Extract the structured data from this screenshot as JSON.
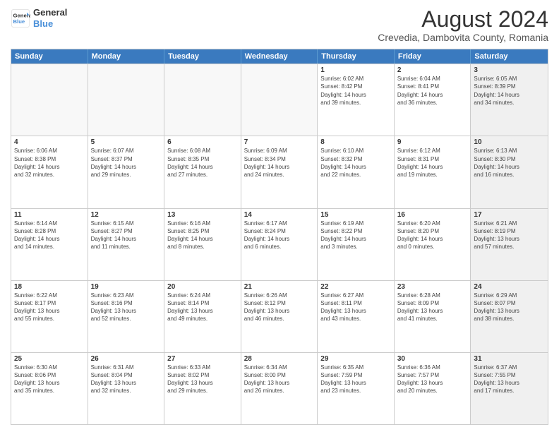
{
  "header": {
    "logo_line1": "General",
    "logo_line2": "Blue",
    "main_title": "August 2024",
    "subtitle": "Crevedia, Dambovita County, Romania"
  },
  "days_of_week": [
    "Sunday",
    "Monday",
    "Tuesday",
    "Wednesday",
    "Thursday",
    "Friday",
    "Saturday"
  ],
  "weeks": [
    [
      {
        "day": "",
        "info": "",
        "shaded": false,
        "empty": true
      },
      {
        "day": "",
        "info": "",
        "shaded": false,
        "empty": true
      },
      {
        "day": "",
        "info": "",
        "shaded": false,
        "empty": true
      },
      {
        "day": "",
        "info": "",
        "shaded": false,
        "empty": true
      },
      {
        "day": "1",
        "info": "Sunrise: 6:02 AM\nSunset: 8:42 PM\nDaylight: 14 hours\nand 39 minutes.",
        "shaded": false,
        "empty": false
      },
      {
        "day": "2",
        "info": "Sunrise: 6:04 AM\nSunset: 8:41 PM\nDaylight: 14 hours\nand 36 minutes.",
        "shaded": false,
        "empty": false
      },
      {
        "day": "3",
        "info": "Sunrise: 6:05 AM\nSunset: 8:39 PM\nDaylight: 14 hours\nand 34 minutes.",
        "shaded": true,
        "empty": false
      }
    ],
    [
      {
        "day": "4",
        "info": "Sunrise: 6:06 AM\nSunset: 8:38 PM\nDaylight: 14 hours\nand 32 minutes.",
        "shaded": false,
        "empty": false
      },
      {
        "day": "5",
        "info": "Sunrise: 6:07 AM\nSunset: 8:37 PM\nDaylight: 14 hours\nand 29 minutes.",
        "shaded": false,
        "empty": false
      },
      {
        "day": "6",
        "info": "Sunrise: 6:08 AM\nSunset: 8:35 PM\nDaylight: 14 hours\nand 27 minutes.",
        "shaded": false,
        "empty": false
      },
      {
        "day": "7",
        "info": "Sunrise: 6:09 AM\nSunset: 8:34 PM\nDaylight: 14 hours\nand 24 minutes.",
        "shaded": false,
        "empty": false
      },
      {
        "day": "8",
        "info": "Sunrise: 6:10 AM\nSunset: 8:32 PM\nDaylight: 14 hours\nand 22 minutes.",
        "shaded": false,
        "empty": false
      },
      {
        "day": "9",
        "info": "Sunrise: 6:12 AM\nSunset: 8:31 PM\nDaylight: 14 hours\nand 19 minutes.",
        "shaded": false,
        "empty": false
      },
      {
        "day": "10",
        "info": "Sunrise: 6:13 AM\nSunset: 8:30 PM\nDaylight: 14 hours\nand 16 minutes.",
        "shaded": true,
        "empty": false
      }
    ],
    [
      {
        "day": "11",
        "info": "Sunrise: 6:14 AM\nSunset: 8:28 PM\nDaylight: 14 hours\nand 14 minutes.",
        "shaded": false,
        "empty": false
      },
      {
        "day": "12",
        "info": "Sunrise: 6:15 AM\nSunset: 8:27 PM\nDaylight: 14 hours\nand 11 minutes.",
        "shaded": false,
        "empty": false
      },
      {
        "day": "13",
        "info": "Sunrise: 6:16 AM\nSunset: 8:25 PM\nDaylight: 14 hours\nand 8 minutes.",
        "shaded": false,
        "empty": false
      },
      {
        "day": "14",
        "info": "Sunrise: 6:17 AM\nSunset: 8:24 PM\nDaylight: 14 hours\nand 6 minutes.",
        "shaded": false,
        "empty": false
      },
      {
        "day": "15",
        "info": "Sunrise: 6:19 AM\nSunset: 8:22 PM\nDaylight: 14 hours\nand 3 minutes.",
        "shaded": false,
        "empty": false
      },
      {
        "day": "16",
        "info": "Sunrise: 6:20 AM\nSunset: 8:20 PM\nDaylight: 14 hours\nand 0 minutes.",
        "shaded": false,
        "empty": false
      },
      {
        "day": "17",
        "info": "Sunrise: 6:21 AM\nSunset: 8:19 PM\nDaylight: 13 hours\nand 57 minutes.",
        "shaded": true,
        "empty": false
      }
    ],
    [
      {
        "day": "18",
        "info": "Sunrise: 6:22 AM\nSunset: 8:17 PM\nDaylight: 13 hours\nand 55 minutes.",
        "shaded": false,
        "empty": false
      },
      {
        "day": "19",
        "info": "Sunrise: 6:23 AM\nSunset: 8:16 PM\nDaylight: 13 hours\nand 52 minutes.",
        "shaded": false,
        "empty": false
      },
      {
        "day": "20",
        "info": "Sunrise: 6:24 AM\nSunset: 8:14 PM\nDaylight: 13 hours\nand 49 minutes.",
        "shaded": false,
        "empty": false
      },
      {
        "day": "21",
        "info": "Sunrise: 6:26 AM\nSunset: 8:12 PM\nDaylight: 13 hours\nand 46 minutes.",
        "shaded": false,
        "empty": false
      },
      {
        "day": "22",
        "info": "Sunrise: 6:27 AM\nSunset: 8:11 PM\nDaylight: 13 hours\nand 43 minutes.",
        "shaded": false,
        "empty": false
      },
      {
        "day": "23",
        "info": "Sunrise: 6:28 AM\nSunset: 8:09 PM\nDaylight: 13 hours\nand 41 minutes.",
        "shaded": false,
        "empty": false
      },
      {
        "day": "24",
        "info": "Sunrise: 6:29 AM\nSunset: 8:07 PM\nDaylight: 13 hours\nand 38 minutes.",
        "shaded": true,
        "empty": false
      }
    ],
    [
      {
        "day": "25",
        "info": "Sunrise: 6:30 AM\nSunset: 8:06 PM\nDaylight: 13 hours\nand 35 minutes.",
        "shaded": false,
        "empty": false
      },
      {
        "day": "26",
        "info": "Sunrise: 6:31 AM\nSunset: 8:04 PM\nDaylight: 13 hours\nand 32 minutes.",
        "shaded": false,
        "empty": false
      },
      {
        "day": "27",
        "info": "Sunrise: 6:33 AM\nSunset: 8:02 PM\nDaylight: 13 hours\nand 29 minutes.",
        "shaded": false,
        "empty": false
      },
      {
        "day": "28",
        "info": "Sunrise: 6:34 AM\nSunset: 8:00 PM\nDaylight: 13 hours\nand 26 minutes.",
        "shaded": false,
        "empty": false
      },
      {
        "day": "29",
        "info": "Sunrise: 6:35 AM\nSunset: 7:59 PM\nDaylight: 13 hours\nand 23 minutes.",
        "shaded": false,
        "empty": false
      },
      {
        "day": "30",
        "info": "Sunrise: 6:36 AM\nSunset: 7:57 PM\nDaylight: 13 hours\nand 20 minutes.",
        "shaded": false,
        "empty": false
      },
      {
        "day": "31",
        "info": "Sunrise: 6:37 AM\nSunset: 7:55 PM\nDaylight: 13 hours\nand 17 minutes.",
        "shaded": true,
        "empty": false
      }
    ]
  ]
}
